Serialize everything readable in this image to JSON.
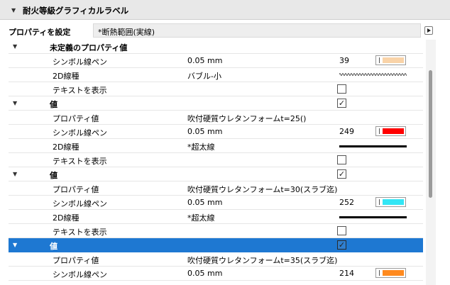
{
  "header": {
    "title": "耐火等級グラフィカルラベル"
  },
  "property": {
    "label": "プロパティを設定",
    "value": "*断熱範囲(実線)"
  },
  "rows": [
    {
      "kind": "group",
      "label": "未定義のプロパティ値"
    },
    {
      "kind": "pen",
      "label": "シンボル線ペン",
      "value": "0.05 mm",
      "pen": "39",
      "color": "#f9d3a8"
    },
    {
      "kind": "line",
      "label": "2D線種",
      "value": "バブル-小",
      "style": "bubble"
    },
    {
      "kind": "check",
      "label": "テキストを表示",
      "checked": false
    },
    {
      "kind": "group",
      "label": "値",
      "checked": true
    },
    {
      "kind": "text",
      "label": "プロパティ値",
      "value": "吹付硬質ウレタンフォームt=25()"
    },
    {
      "kind": "pen",
      "label": "シンボル線ペン",
      "value": "0.05 mm",
      "pen": "249",
      "color": "#ff0000"
    },
    {
      "kind": "line",
      "label": "2D線種",
      "value": "*超太線",
      "style": "solid"
    },
    {
      "kind": "check",
      "label": "テキストを表示",
      "checked": false
    },
    {
      "kind": "group",
      "label": "値",
      "checked": true
    },
    {
      "kind": "text",
      "label": "プロパティ値",
      "value": "吹付硬質ウレタンフォームt=30(スラブ迄)"
    },
    {
      "kind": "pen",
      "label": "シンボル線ペン",
      "value": "0.05 mm",
      "pen": "252",
      "color": "#33e6f5"
    },
    {
      "kind": "line",
      "label": "2D線種",
      "value": "*超太線",
      "style": "solid"
    },
    {
      "kind": "check",
      "label": "テキストを表示",
      "checked": false
    },
    {
      "kind": "group",
      "label": "値",
      "checked": true,
      "selected": true
    },
    {
      "kind": "text",
      "label": "プロパティ値",
      "value": "吹付硬質ウレタンフォームt=35(スラブ迄)"
    },
    {
      "kind": "pen",
      "label": "シンボル線ペン",
      "value": "0.05 mm",
      "pen": "214",
      "color": "#ff8a1f"
    }
  ]
}
